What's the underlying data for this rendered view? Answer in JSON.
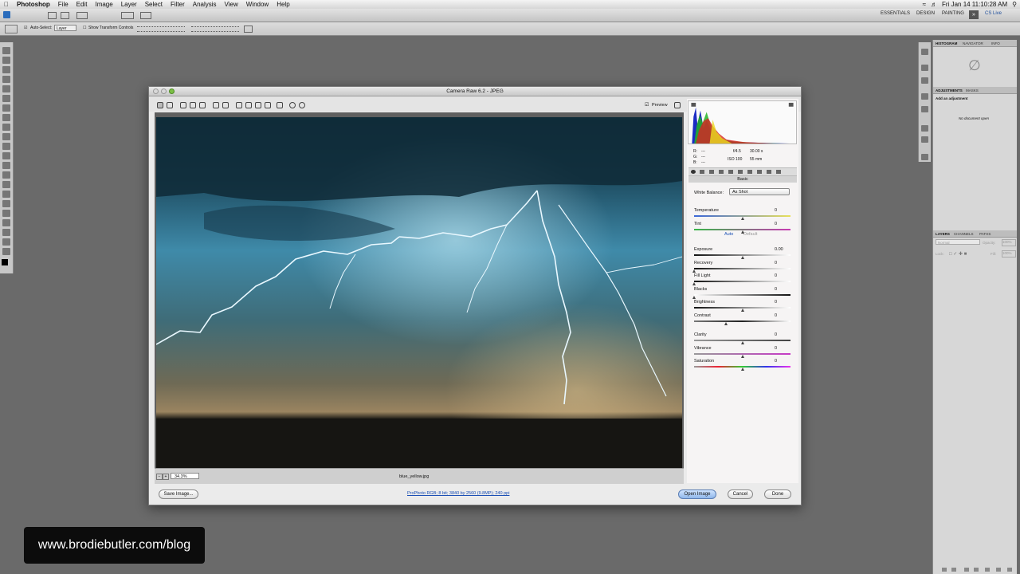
{
  "menubar": {
    "app": "Photoshop",
    "items": [
      "File",
      "Edit",
      "Image",
      "Layer",
      "Select",
      "Filter",
      "Analysis",
      "View",
      "Window",
      "Help"
    ],
    "clock": "Fri Jan 14  11:10:28 AM",
    "cs_live": "CS Live"
  },
  "appbar": {
    "workspaces": [
      "ESSENTIALS",
      "DESIGN",
      "PAINTING"
    ]
  },
  "options": {
    "auto_select": "Auto-Select:",
    "layer_value": "Layer",
    "show_transform": "Show Transform Controls"
  },
  "dialog": {
    "title": "Camera Raw 6.2  -  JPEG",
    "preview_label": "Preview",
    "zoom": "34.3%",
    "filename": "blue_yellow.jpg",
    "workflow_link": "ProPhoto RGB; 8 bit; 3840 by 2560 (9.8MP); 240 ppi",
    "buttons": {
      "save": "Save Image...",
      "open": "Open Image",
      "cancel": "Cancel",
      "done": "Done"
    }
  },
  "side": {
    "rgb_labels": [
      "R:",
      "G:",
      "B:"
    ],
    "rgb_values": [
      "---",
      "---",
      "---"
    ],
    "aperture": "f/4.5",
    "shutter": "30.00 s",
    "iso": "ISO 100",
    "focal": "55 mm",
    "panel_title": "Basic",
    "white_balance_label": "White Balance:",
    "white_balance_value": "As Shot",
    "auto": "Auto",
    "default": "Default",
    "sliders": [
      {
        "name": "Temperature",
        "value": "0",
        "pos": 0.5
      },
      {
        "name": "Tint",
        "value": "0",
        "pos": 0.5
      },
      {
        "name": "Exposure",
        "value": "0.00",
        "pos": 0.5
      },
      {
        "name": "Recovery",
        "value": "0",
        "pos": 0.0
      },
      {
        "name": "Fill Light",
        "value": "0",
        "pos": 0.0
      },
      {
        "name": "Blacks",
        "value": "0",
        "pos": 0.0
      },
      {
        "name": "Brightness",
        "value": "0",
        "pos": 0.5
      },
      {
        "name": "Contrast",
        "value": "0",
        "pos": 0.33
      },
      {
        "name": "Clarity",
        "value": "0",
        "pos": 0.5
      },
      {
        "name": "Vibrance",
        "value": "0",
        "pos": 0.5
      },
      {
        "name": "Saturation",
        "value": "0",
        "pos": 0.5
      }
    ]
  },
  "panels": {
    "top_tabs": [
      "HISTOGRAM",
      "NAVIGATOR",
      "INFO"
    ],
    "adj_tabs": [
      "ADJUSTMENTS",
      "MASKS"
    ],
    "add_adjustment": "Add an adjustment",
    "no_document": "No document open",
    "layer_tabs": [
      "LAYERS",
      "CHANNELS",
      "PATHS"
    ],
    "blend_mode": "Normal",
    "opacity_label": "Opacity:",
    "opacity_value": "100%",
    "lock_label": "Lock:",
    "fill_label": "Fill:",
    "fill_value": "100%"
  },
  "watermark": "www.brodiebutler.com/blog"
}
